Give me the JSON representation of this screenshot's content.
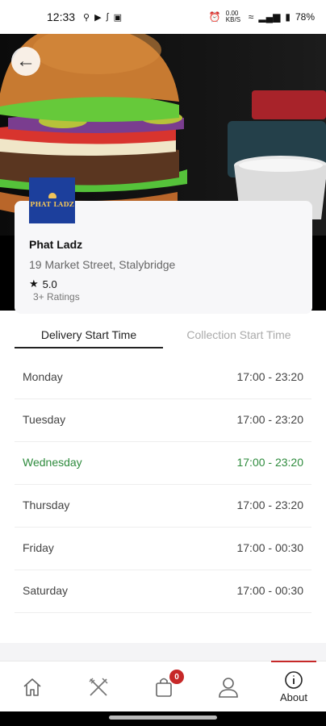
{
  "status_bar": {
    "time": "12:33",
    "battery": "78%",
    "data_rate": "0.00 KB/S"
  },
  "restaurant": {
    "logo_text": "PHAT LADZ",
    "name": "Phat Ladz",
    "address": "19 Market Street, Stalybridge",
    "rating": "5.0",
    "rating_count": "3+ Ratings"
  },
  "tabs": {
    "delivery": "Delivery Start Time",
    "collection": "Collection Start Time"
  },
  "hours": [
    {
      "day": "Monday",
      "time": "17:00 - 23:20"
    },
    {
      "day": "Tuesday",
      "time": "17:00 - 23:20"
    },
    {
      "day": "Wednesday",
      "time": "17:00 - 23:20"
    },
    {
      "day": "Thursday",
      "time": "17:00 - 23:20"
    },
    {
      "day": "Friday",
      "time": "17:00 - 00:30"
    },
    {
      "day": "Saturday",
      "time": "17:00 - 00:30"
    }
  ],
  "nav": {
    "cart_count": "0",
    "about_label": "About"
  },
  "colors": {
    "accent": "#c62828",
    "active_day": "#2e8b3d",
    "logo_bg": "#1c3f9c"
  }
}
